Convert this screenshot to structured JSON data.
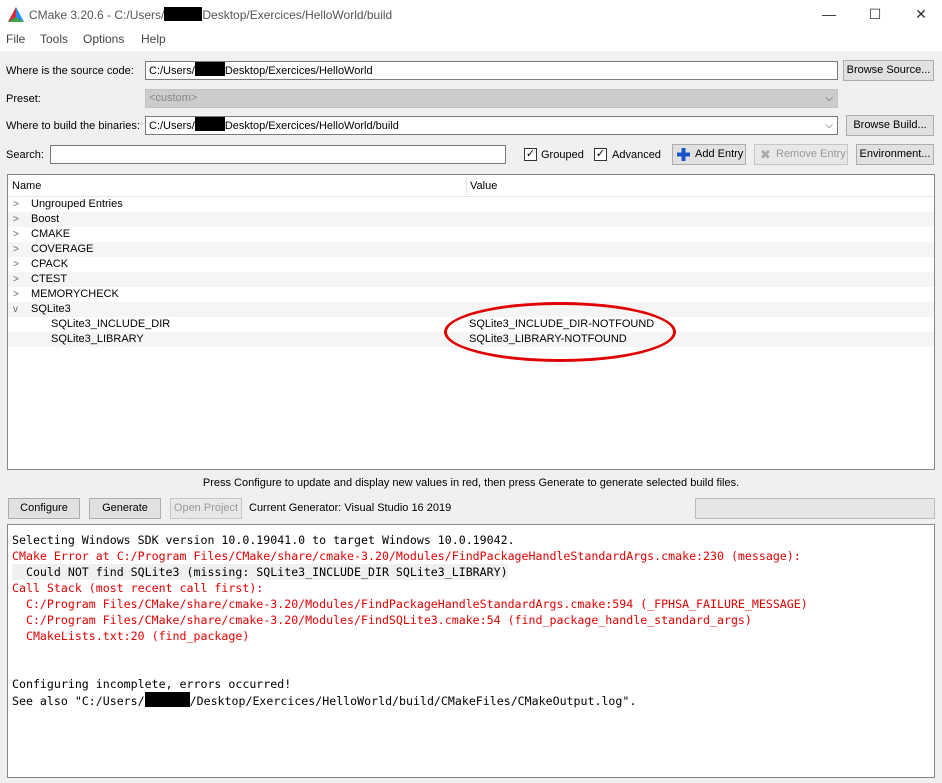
{
  "window": {
    "title_prefix": "CMake 3.20.6 - C:/Users/",
    "title_suffix": "Desktop/Exercices/HelloWorld/build",
    "minimize": "—",
    "maximize": "☐",
    "close": "✕"
  },
  "menu": [
    "File",
    "Tools",
    "Options",
    "Help"
  ],
  "source": {
    "label": "Where is the source code:",
    "value_prefix": "C:/Users/",
    "value_suffix": "Desktop/Exercices/HelloWorld",
    "browse": "Browse Source..."
  },
  "preset": {
    "label": "Preset:",
    "value": "<custom>"
  },
  "build": {
    "label": "Where to build the binaries:",
    "value_prefix": "C:/Users/",
    "value_suffix": "Desktop/Exercices/HelloWorld/build",
    "browse": "Browse Build..."
  },
  "search": {
    "label": "Search:",
    "value": ""
  },
  "options": {
    "grouped": "Grouped",
    "advanced": "Advanced",
    "check_mark": "✓",
    "add_entry": "Add Entry",
    "remove_entry": "Remove Entry",
    "environment": "Environment..."
  },
  "tree": {
    "col_name": "Name",
    "col_value": "Value",
    "groups": [
      {
        "name": "Ungrouped Entries",
        "arrow": ">"
      },
      {
        "name": "Boost",
        "arrow": ">"
      },
      {
        "name": "CMAKE",
        "arrow": ">"
      },
      {
        "name": "COVERAGE",
        "arrow": ">"
      },
      {
        "name": "CPACK",
        "arrow": ">"
      },
      {
        "name": "CTEST",
        "arrow": ">"
      },
      {
        "name": "MEMORYCHECK",
        "arrow": ">"
      },
      {
        "name": "SQLite3",
        "arrow": "v"
      }
    ],
    "children": [
      {
        "name": "SQLite3_INCLUDE_DIR",
        "value": "SQLite3_INCLUDE_DIR-NOTFOUND"
      },
      {
        "name": "SQLite3_LIBRARY",
        "value": "SQLite3_LIBRARY-NOTFOUND"
      }
    ]
  },
  "hint": "Press Configure to update and display new values in red, then press Generate to generate selected build files.",
  "actions": {
    "configure": "Configure",
    "generate": "Generate",
    "open_project": "Open Project",
    "generator": "Current Generator: Visual Studio 16 2019"
  },
  "output": [
    {
      "text": "Selecting Windows SDK version 10.0.19041.0 to target Windows 10.0.19042.",
      "type": "normal"
    },
    {
      "text": "CMake Error at C:/Program Files/CMake/share/cmake-3.20/Modules/FindPackageHandleStandardArgs.cmake:230 (message):",
      "type": "error"
    },
    {
      "text": "  Could NOT find SQLite3 (missing: SQLite3_INCLUDE_DIR SQLite3_LIBRARY)",
      "type": "highlight"
    },
    {
      "text": "Call Stack (most recent call first):",
      "type": "error"
    },
    {
      "text": "  C:/Program Files/CMake/share/cmake-3.20/Modules/FindPackageHandleStandardArgs.cmake:594 (_FPHSA_FAILURE_MESSAGE)",
      "type": "error"
    },
    {
      "text": "  C:/Program Files/CMake/share/cmake-3.20/Modules/FindSQLite3.cmake:54 (find_package_handle_standard_args)",
      "type": "error"
    },
    {
      "text": "  CMakeLists.txt:20 (find_package)",
      "type": "error"
    },
    {
      "text": "",
      "type": "normal"
    },
    {
      "text": "",
      "type": "normal"
    },
    {
      "text": "Configuring incomplete, errors occurred!",
      "type": "normal"
    },
    {
      "text": "See also \"C:/Users/",
      "type": "normal"
    }
  ],
  "output_last_suffix": "/Desktop/Exercices/HelloWorld/build/CMakeFiles/CMakeOutput.log\"."
}
